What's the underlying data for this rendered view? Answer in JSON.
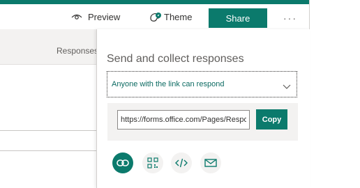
{
  "toolbar": {
    "preview_label": "Preview",
    "theme_label": "Theme",
    "share_label": "Share",
    "more_label": "···"
  },
  "background": {
    "tab_label": "Responses"
  },
  "panel": {
    "title": "Send and collect responses",
    "audience_selected": "Anyone with the link can respond",
    "link_value": "https://forms.office.com/Pages/ResponsePage.aspx",
    "copy_label": "Copy",
    "share_options": [
      {
        "icon": "link-icon",
        "active": true
      },
      {
        "icon": "qr-code-icon",
        "active": false
      },
      {
        "icon": "embed-code-icon",
        "active": false
      },
      {
        "icon": "email-icon",
        "active": false
      }
    ]
  },
  "colors": {
    "accent": "#0b7a6c",
    "accent_text": "#0b6a61",
    "panel_bg": "#ffffff",
    "muted_bg": "#f3f2f1"
  }
}
